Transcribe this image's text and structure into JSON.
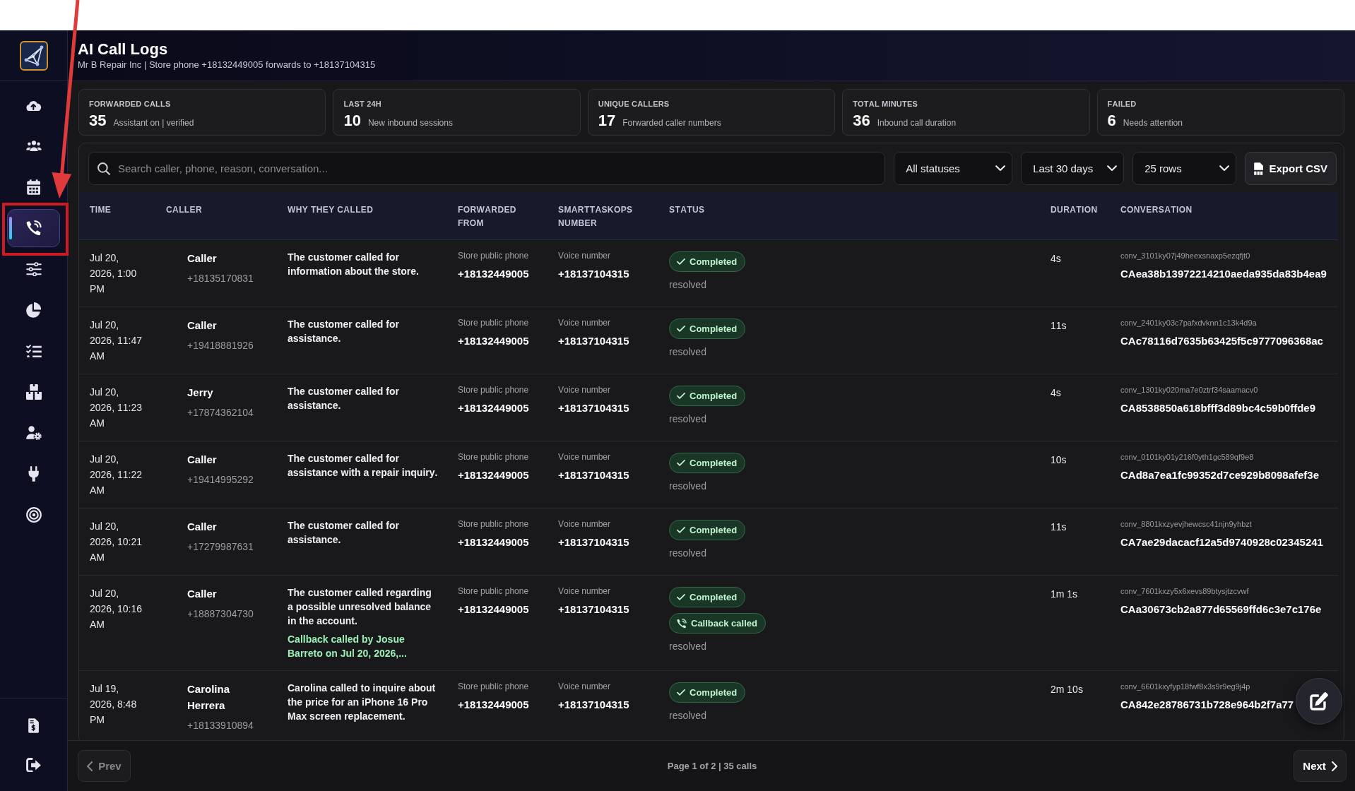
{
  "header": {
    "title": "AI Call Logs",
    "subtitle": "Mr B Repair Inc | Store phone +18132449005 forwards to +18137104315"
  },
  "sidebar": {
    "items": [
      {
        "kind": "cloud",
        "selected": false
      },
      {
        "kind": "users",
        "selected": false
      },
      {
        "kind": "calendar",
        "selected": false
      },
      {
        "kind": "phone",
        "selected": true
      },
      {
        "kind": "sliders",
        "selected": false
      },
      {
        "kind": "pie",
        "selected": false
      },
      {
        "kind": "checklist",
        "selected": false
      },
      {
        "kind": "boxes",
        "selected": false
      },
      {
        "kind": "usergear",
        "selected": false
      },
      {
        "kind": "plug",
        "selected": false
      },
      {
        "kind": "target",
        "selected": false
      }
    ],
    "bottom_items": [
      {
        "kind": "invoice",
        "selected": false
      },
      {
        "kind": "exit",
        "selected": false
      }
    ]
  },
  "stats": [
    {
      "label": "FORWARDED CALLS",
      "value": "35",
      "note": "Assistant on | verified"
    },
    {
      "label": "LAST 24H",
      "value": "10",
      "note": "New inbound sessions"
    },
    {
      "label": "UNIQUE CALLERS",
      "value": "17",
      "note": "Forwarded caller numbers"
    },
    {
      "label": "TOTAL MINUTES",
      "value": "36",
      "note": "Inbound call duration"
    },
    {
      "label": "FAILED",
      "value": "6",
      "note": "Needs attention"
    }
  ],
  "toolbar": {
    "search": {
      "placeholder": "Search caller, phone, reason, conversation..."
    },
    "filters": [
      {
        "value": "All statuses"
      },
      {
        "value": "Last 30 days"
      },
      {
        "value": "25 rows"
      }
    ],
    "export_button": {
      "label": "Export CSV"
    }
  },
  "table": {
    "columns": [
      "TIME",
      "CALLER",
      "WHY THEY CALLED",
      "FORWARDED FROM",
      "SMARTTASKOPS NUMBER",
      "STATUS",
      "DURATION",
      "CONVERSATION"
    ],
    "rows": [
      {
        "time": "Jul 20, 2026, 1:00 PM",
        "caller": {
          "name": "Caller",
          "phone": "+18135170831"
        },
        "reason": "The customer called for information about the store.",
        "forwarded_from": {
          "label": "Store public phone",
          "number": "+18132449005"
        },
        "smarttaskops_number": {
          "label": "Voice number",
          "number": "+18137104315"
        },
        "statuses": [
          {
            "kind": "completed",
            "label": "Completed"
          }
        ],
        "resolution": "resolved",
        "duration": "4s",
        "conversation": {
          "conv_id": "conv_3101ky07j49heexsnaxp5ezqfjt0",
          "call_sid": "CAea38b13972214210aeda935da83b4ea9"
        }
      },
      {
        "time": "Jul 20, 2026, 11:47 AM",
        "caller": {
          "name": "Caller",
          "phone": "+19418881926"
        },
        "reason": "The customer called for assistance.",
        "forwarded_from": {
          "label": "Store public phone",
          "number": "+18132449005"
        },
        "smarttaskops_number": {
          "label": "Voice number",
          "number": "+18137104315"
        },
        "statuses": [
          {
            "kind": "completed",
            "label": "Completed"
          }
        ],
        "resolution": "resolved",
        "duration": "11s",
        "conversation": {
          "conv_id": "conv_2401ky03c7pafxdvknn1c13k4d9a",
          "call_sid": "CAc78116d7635b63425f5c9777096368ac"
        }
      },
      {
        "time": "Jul 20, 2026, 11:23 AM",
        "caller": {
          "name": "Jerry",
          "phone": "+17874362104"
        },
        "reason": "The customer called for assistance.",
        "forwarded_from": {
          "label": "Store public phone",
          "number": "+18132449005"
        },
        "smarttaskops_number": {
          "label": "Voice number",
          "number": "+18137104315"
        },
        "statuses": [
          {
            "kind": "completed",
            "label": "Completed"
          }
        ],
        "resolution": "resolved",
        "duration": "4s",
        "conversation": {
          "conv_id": "conv_1301ky020ma7e0ztrf34saamacv0",
          "call_sid": "CA8538850a618bfff3d89bc4c59b0ffde9"
        }
      },
      {
        "time": "Jul 20, 2026, 11:22 AM",
        "caller": {
          "name": "Caller",
          "phone": "+19414995292"
        },
        "reason": "The customer called for assistance with a repair inquiry.",
        "forwarded_from": {
          "label": "Store public phone",
          "number": "+18132449005"
        },
        "smarttaskops_number": {
          "label": "Voice number",
          "number": "+18137104315"
        },
        "statuses": [
          {
            "kind": "completed",
            "label": "Completed"
          }
        ],
        "resolution": "resolved",
        "duration": "10s",
        "conversation": {
          "conv_id": "conv_0101ky01y216f0yth1gc589qf9e8",
          "call_sid": "CAd8a7ea1fc99352d7ce929b8098afef3e"
        }
      },
      {
        "time": "Jul 20, 2026, 10:21 AM",
        "caller": {
          "name": "Caller",
          "phone": "+17279987631"
        },
        "reason": "The customer called for assistance.",
        "forwarded_from": {
          "label": "Store public phone",
          "number": "+18132449005"
        },
        "smarttaskops_number": {
          "label": "Voice number",
          "number": "+18137104315"
        },
        "statuses": [
          {
            "kind": "completed",
            "label": "Completed"
          }
        ],
        "resolution": "resolved",
        "duration": "11s",
        "conversation": {
          "conv_id": "conv_8801kxzyevjhewcsc41njn9yhbzt",
          "call_sid": "CA7ae29dacacf12a5d9740928c02345241"
        }
      },
      {
        "time": "Jul 20, 2026, 10:16 AM",
        "caller": {
          "name": "Caller",
          "phone": "+18887304730"
        },
        "reason": "The customer called regarding a possible unresolved balance in the account.",
        "note": "Callback called by Josue Barreto on Jul 20, 2026,...",
        "forwarded_from": {
          "label": "Store public phone",
          "number": "+18132449005"
        },
        "smarttaskops_number": {
          "label": "Voice number",
          "number": "+18137104315"
        },
        "statuses": [
          {
            "kind": "completed",
            "label": "Completed"
          },
          {
            "kind": "callback",
            "label": "Callback called"
          }
        ],
        "resolution": "resolved",
        "duration": "1m 1s",
        "conversation": {
          "conv_id": "conv_7601kxzy5x6xevs89btysjtzcvwf",
          "call_sid": "CAa30673cb2a877d65569ffd6c3e7c176e"
        }
      },
      {
        "time": "Jul 19, 2026, 8:48 PM",
        "caller": {
          "name": "Carolina Herrera",
          "phone": "+18133910894"
        },
        "reason": "Carolina called to inquire about the price for an iPhone 16 Pro Max screen replacement.",
        "forwarded_from": {
          "label": "Store public phone",
          "number": "+18132449005"
        },
        "smarttaskops_number": {
          "label": "Voice number",
          "number": "+18137104315"
        },
        "statuses": [
          {
            "kind": "completed",
            "label": "Completed"
          }
        ],
        "resolution": "resolved",
        "duration": "2m 10s",
        "conversation": {
          "conv_id": "conv_6601kxyfyp18fwf8x3s9r9eg9j4p",
          "call_sid": "CA842e28786731b728e964b2f7a77"
        }
      }
    ]
  },
  "pagination": {
    "prev": {
      "label": "Prev",
      "disabled": true
    },
    "info": "Page 1 of 2 | 35 calls",
    "next": {
      "label": "Next",
      "disabled": false
    }
  }
}
